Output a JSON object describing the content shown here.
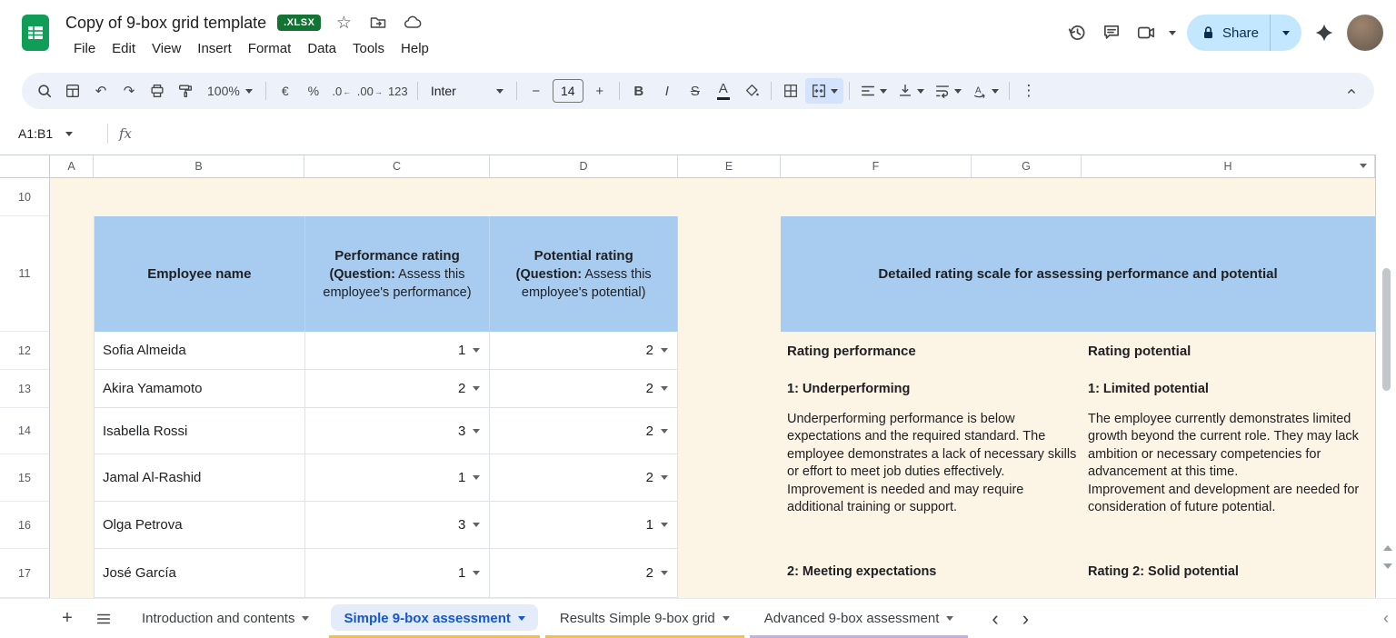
{
  "titlebar": {
    "title": "Copy of 9-box grid template",
    "badge": ".XLSX",
    "menus": [
      "File",
      "Edit",
      "View",
      "Insert",
      "Format",
      "Data",
      "Tools",
      "Help"
    ],
    "share_label": "Share"
  },
  "icons": {
    "star": "☆",
    "undo": "↶",
    "redo": "↷",
    "more": "⋮",
    "plus": "+",
    "minus": "−",
    "chevron_left": "‹",
    "chevron_right": "›",
    "dec_left_arrow": "←",
    "dec_right_arrow": "→"
  },
  "toolbar": {
    "zoom": "100%",
    "currency": "€",
    "percent": "%",
    "dec_decrease": ".0",
    "dec_increase": ".00",
    "plain_format": "123",
    "font": "Inter",
    "font_size": "14",
    "bold": "B",
    "italic": "I",
    "strikethrough": "S",
    "text_color": "A"
  },
  "formula_bar": {
    "name_box": "A1:B1",
    "fx": "fx"
  },
  "grid": {
    "columns": [
      "A",
      "B",
      "C",
      "D",
      "E",
      "F",
      "G",
      "H"
    ],
    "rows": [
      "10",
      "11",
      "12",
      "13",
      "14",
      "15",
      "16",
      "17"
    ]
  },
  "left_table": {
    "name_header": "Employee name",
    "perf_header": {
      "title": "Performance rating",
      "q": "(Question:",
      "text": " Assess this employee's performance)"
    },
    "pot_header": {
      "title": "Potential rating",
      "q": "(Question:",
      "text": " Assess this employee's potential)"
    },
    "employees": [
      {
        "name": "Sofia Almeida",
        "performance": "1",
        "potential": "2"
      },
      {
        "name": "Akira Yamamoto",
        "performance": "2",
        "potential": "2"
      },
      {
        "name": "Isabella Rossi",
        "performance": "3",
        "potential": "2"
      },
      {
        "name": "Jamal Al-Rashid",
        "performance": "1",
        "potential": "2"
      },
      {
        "name": "Olga Petrova",
        "performance": "3",
        "potential": "1"
      },
      {
        "name": "José García",
        "performance": "1",
        "potential": "2"
      }
    ]
  },
  "rating_scale": {
    "title": "Detailed rating scale for assessing performance and potential",
    "performance": {
      "header": "Rating performance",
      "level1": "1: Underperforming",
      "body": "Underperforming performance is below expectations and the required standard. The employee demonstrates a lack of necessary skills or effort to meet job duties effectively.\nImprovement is needed and may require additional training or support.",
      "next_level": "2: Meeting expectations"
    },
    "potential": {
      "header": "Rating potential",
      "level1": "1: Limited potential",
      "body": "The employee currently demonstrates limited growth beyond the current role. They may lack ambition or necessary competencies for advancement at this time.\nImprovement and development are needed for consideration of future potential.",
      "next_level": "Rating 2: Solid potential"
    }
  },
  "tabs": {
    "items": [
      {
        "label": "Introduction and contents"
      },
      {
        "label": "Simple 9-box assessment"
      },
      {
        "label": "Results Simple 9-box grid"
      },
      {
        "label": "Advanced 9-box assessment"
      }
    ]
  }
}
